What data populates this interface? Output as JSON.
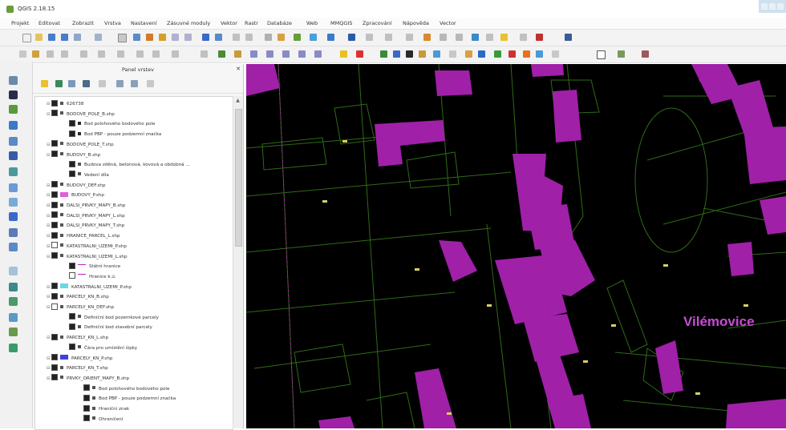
{
  "window": {
    "title": "QGIS 2.18.15"
  },
  "menu": [
    "Projekt",
    "Editovat",
    "Zobrazit",
    "Vrstva",
    "Nastavení",
    "Zásuvné moduly",
    "Vektor",
    "Rastr",
    "Databáze",
    "Web",
    "MMQGIS",
    "Zpracování",
    "Nápověda",
    "Vector"
  ],
  "panel": {
    "title": "Panel vrstev"
  },
  "layers": [
    {
      "label": "626738",
      "checked": true,
      "symbol": "none"
    },
    {
      "label": "BODOVE_POLE_B.shp",
      "checked": true,
      "symbol": "none"
    },
    {
      "label": "Bod polohového bodového pole",
      "checked": true,
      "symbol": "point"
    },
    {
      "label": "Bod PBP - pouze podzemní značka",
      "checked": true,
      "symbol": "point"
    },
    {
      "label": "BODOVE_POLE_T.shp",
      "checked": true,
      "symbol": "none"
    },
    {
      "label": "BUDOVY_B.shp",
      "checked": true,
      "symbol": "none"
    },
    {
      "label": "Budova zděná, betonová, kovová a obdobná ...",
      "checked": true,
      "symbol": "none"
    },
    {
      "label": "Vedení díla",
      "checked": true,
      "symbol": "none"
    },
    {
      "label": "BUDOVY_DEF.shp",
      "checked": true,
      "symbol": "none"
    },
    {
      "label": "BUDOVY_P.shp",
      "checked": true,
      "symbol": "fill-magenta"
    },
    {
      "label": "DALSI_PRVKY_MAPY_B.shp",
      "checked": true,
      "symbol": "none"
    },
    {
      "label": "DALSI_PRVKY_MAPY_L.shp",
      "checked": true,
      "symbol": "none"
    },
    {
      "label": "DALSI_PRVKY_MAPY_T.shp",
      "checked": true,
      "symbol": "none"
    },
    {
      "label": "HRANICE_PARCEL_L.shp",
      "checked": true,
      "symbol": "none"
    },
    {
      "label": "KATASTRALNI_UZEMI_P.shp",
      "checked": false,
      "symbol": "none"
    },
    {
      "label": "KATASTRALNI_UZEMI_L.shp",
      "checked": true,
      "symbol": "none"
    },
    {
      "label": "Státní hranice",
      "checked": true,
      "symbol": "line-magenta"
    },
    {
      "label": "Hranice k.ú.",
      "checked": false,
      "symbol": "line-magenta"
    },
    {
      "label": "KATASTRALNI_UZEMI_P.shp",
      "checked": true,
      "symbol": "fill-cyan"
    },
    {
      "label": "PARCELY_KN_B.shp",
      "checked": true,
      "symbol": "none"
    },
    {
      "label": "PARCELY_KN_DEF.shp",
      "checked": false,
      "symbol": "none"
    },
    {
      "label": "Definiční bod pozemkové parcely",
      "checked": true,
      "symbol": "none"
    },
    {
      "label": "Definiční bod stavební parcely",
      "checked": true,
      "symbol": "none"
    },
    {
      "label": "PARCELY_KN_L.shp",
      "checked": true,
      "symbol": "none"
    },
    {
      "label": "Čára pro umístění šipky",
      "checked": true,
      "symbol": "none"
    },
    {
      "label": "PARCELY_KN_P.shp",
      "checked": true,
      "symbol": "fill-blue"
    },
    {
      "label": "PARCELY_KN_T.shp",
      "checked": true,
      "symbol": "none"
    },
    {
      "label": "PRVKY_ORIENT_MAPY_B.shp",
      "checked": true,
      "symbol": "none"
    },
    {
      "label": "Bod polohového bodového pole",
      "checked": true,
      "symbol": "none"
    },
    {
      "label": "Bod PBP - pouze podzemní značka",
      "checked": true,
      "symbol": "none"
    },
    {
      "label": "Hraniční znak",
      "checked": true,
      "symbol": "none"
    },
    {
      "label": "Ohraničení",
      "checked": true,
      "symbol": "none"
    }
  ],
  "map": {
    "place_label": "Vilémovice"
  },
  "colors": {
    "building": "#a020a8",
    "parcel_line": "#3a7a1a",
    "background": "#000000",
    "place_label": "#c94bd8"
  }
}
